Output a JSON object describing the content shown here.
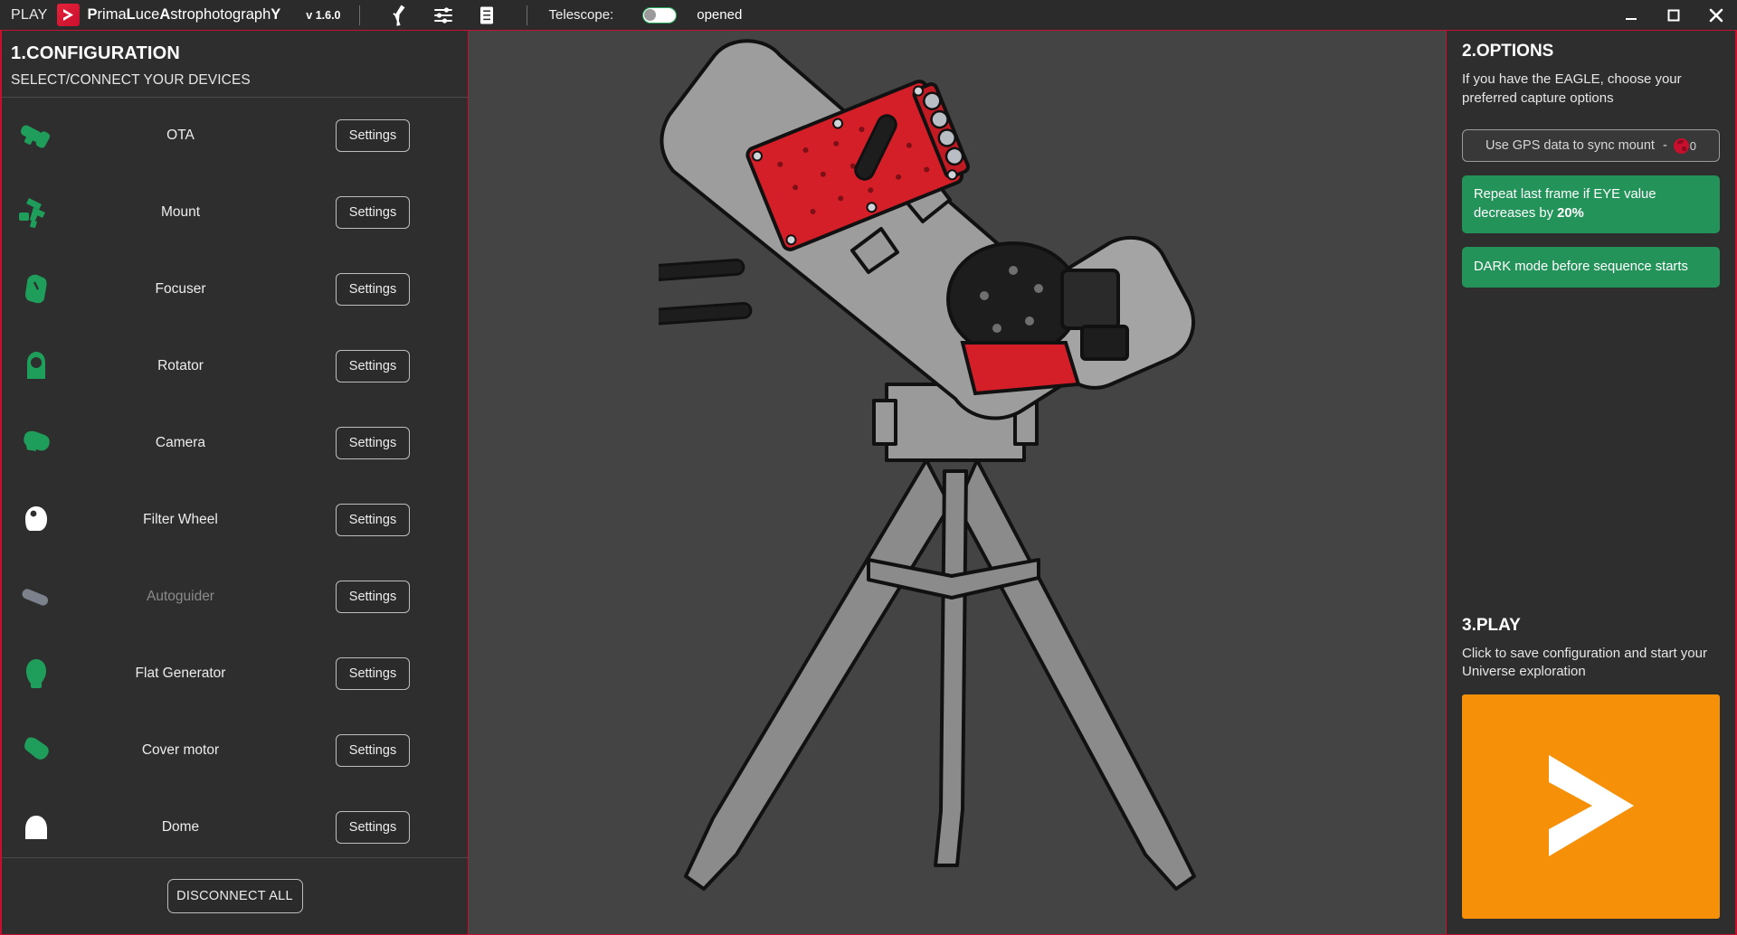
{
  "titlebar": {
    "play_label": "PLAY",
    "logo_icon": "chevron-right-logo",
    "brand_parts": [
      {
        "t": "P",
        "bold": true
      },
      {
        "t": "rima",
        "bold": false
      },
      {
        "t": "L",
        "bold": true
      },
      {
        "t": "uce",
        "bold": false
      },
      {
        "t": "A",
        "bold": true
      },
      {
        "t": "strophotograph",
        "bold": false
      },
      {
        "t": "Y",
        "bold": true
      }
    ],
    "brand_plain": "PrimaLuceAstrophotographY",
    "version": "v 1.6.0",
    "icons": [
      "telescope-icon",
      "sliders-icon",
      "log-book-icon"
    ],
    "telescope_label": "Telescope:",
    "telescope_toggle_on": false,
    "telescope_status": "opened",
    "window_buttons": [
      "minimize-button",
      "maximize-button",
      "close-button"
    ]
  },
  "configuration": {
    "title": "1.CONFIGURATION",
    "subtitle": "SELECT/CONNECT YOUR DEVICES",
    "settings_label": "Settings",
    "disconnect_label": "DISCONNECT ALL",
    "devices": [
      {
        "name": "OTA",
        "icon": "ota-icon",
        "state": "connected"
      },
      {
        "name": "Mount",
        "icon": "mount-icon",
        "state": "connected"
      },
      {
        "name": "Focuser",
        "icon": "focuser-icon",
        "state": "connected"
      },
      {
        "name": "Rotator",
        "icon": "rotator-icon",
        "state": "connected"
      },
      {
        "name": "Camera",
        "icon": "camera-icon",
        "state": "connected"
      },
      {
        "name": "Filter Wheel",
        "icon": "filter-wheel-icon",
        "state": "idle"
      },
      {
        "name": "Autoguider",
        "icon": "autoguider-icon",
        "state": "disabled"
      },
      {
        "name": "Flat Generator",
        "icon": "flat-generator-icon",
        "state": "connected"
      },
      {
        "name": "Cover motor",
        "icon": "cover-motor-icon",
        "state": "connected"
      },
      {
        "name": "Dome",
        "icon": "dome-icon",
        "state": "idle"
      }
    ]
  },
  "options": {
    "title": "2.OPTIONS",
    "description": "If you have the EAGLE, choose your preferred capture options",
    "gps_label": "Use GPS data to sync mount",
    "gps_dash": "-",
    "gps_count": "0",
    "repeat_text_1": "Repeat last frame if EYE value decreases by ",
    "repeat_value": "20%",
    "dark_mode_label": "DARK mode before sequence starts"
  },
  "play": {
    "title": "3.PLAY",
    "description": "Click to save configuration and start your Universe exploration",
    "button_icon": "play-chevron-icon"
  },
  "colors": {
    "accent_red": "#c8102e",
    "green": "#23935a",
    "orange": "#f79009",
    "panel_bg": "#2e2e2e",
    "canvas_bg": "#444444",
    "icon_green": "#1e9e5a",
    "icon_white": "#ffffff",
    "icon_gray": "#7b828c"
  }
}
